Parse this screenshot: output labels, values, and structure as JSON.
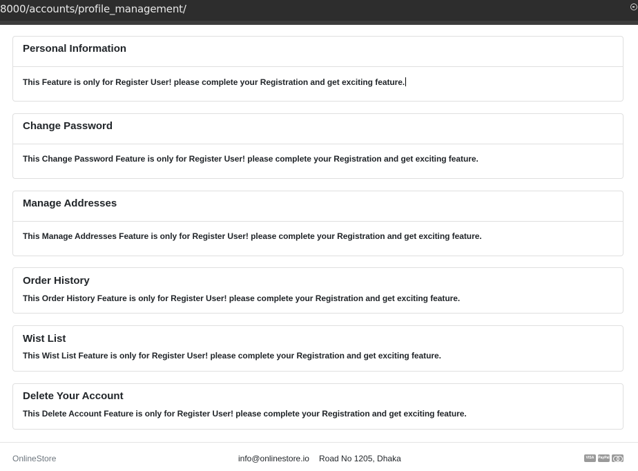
{
  "browser": {
    "url": "8000/accounts/profile_management/",
    "corner_icon": "minus-circle-icon"
  },
  "sections": [
    {
      "title": "Personal Information",
      "message": "This Feature is only for Register User! please complete your Registration and get exciting feature."
    },
    {
      "title": "Change Password",
      "message": "This Change Password Feature is only for Register User! please complete your Registration and get exciting feature."
    },
    {
      "title": "Manage Addresses",
      "message": "This Manage Addresses Feature is only for Register User! please complete your Registration and get exciting feature."
    },
    {
      "title": "Order History",
      "message": "This Order History Feature is only for Register User! please complete your Registration and get exciting feature."
    },
    {
      "title": "Wist List",
      "message": "This Wist List Feature is only for Register User! please complete your Registration and get exciting feature."
    },
    {
      "title": "Delete Your Account",
      "message": "This Delete Account Feature is only for Register User! please complete your Registration and get exciting feature."
    }
  ],
  "footer": {
    "brand": "OnlineStore",
    "email": "info@onlinestore.io",
    "address": "Road No 1205, Dhaka",
    "payment_icons": [
      {
        "name": "visa-icon",
        "label": "VISA"
      },
      {
        "name": "paypal-icon",
        "label": "PayPal"
      },
      {
        "name": "mastercard-icon",
        "label": ""
      }
    ]
  },
  "colors": {
    "browser_bar": "#2d2d2d",
    "text": "#212529",
    "muted": "#6c757d",
    "border": "#dfdfdf"
  }
}
